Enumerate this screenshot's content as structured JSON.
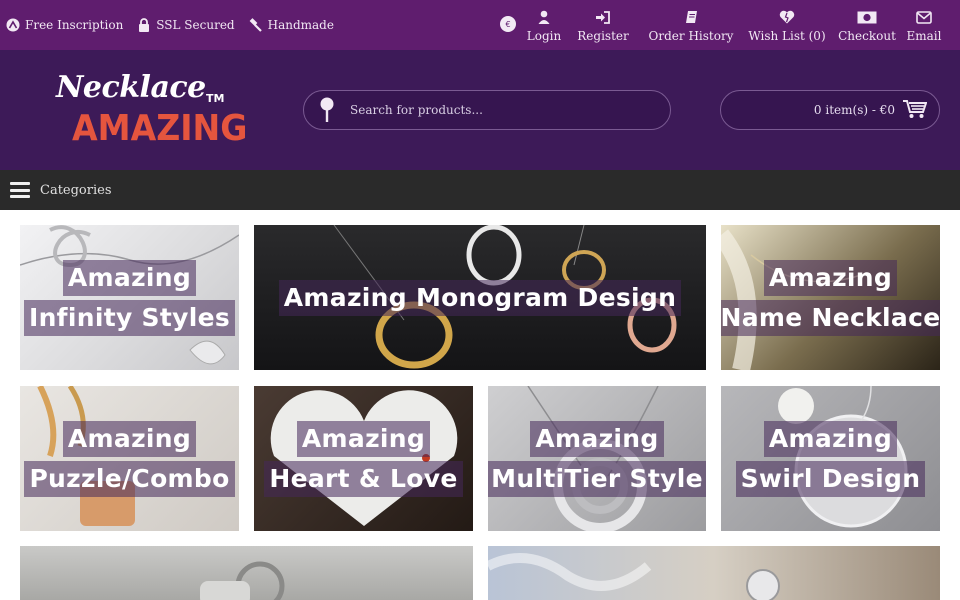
{
  "topbar": {
    "perks": [
      {
        "icon": "euro-circle-icon",
        "label": "Free Inscription"
      },
      {
        "icon": "lock-icon",
        "label": "SSL Secured"
      },
      {
        "icon": "hammer-icon",
        "label": "Handmade"
      }
    ],
    "currency_symbol": "€",
    "links": [
      {
        "icon": "user-icon",
        "label": "Login"
      },
      {
        "icon": "sign-in-icon",
        "label": "Register"
      },
      {
        "icon": "book-icon",
        "label": "Order History"
      },
      {
        "icon": "heart-icon",
        "label": "Wish List (0)"
      },
      {
        "icon": "money-icon",
        "label": "Checkout"
      },
      {
        "icon": "envelope-icon",
        "label": "Email"
      }
    ]
  },
  "header": {
    "logo_script": "Necklace",
    "logo_tm": "TM",
    "logo_main": "AMAZING",
    "search_placeholder": "Search for products...",
    "cart_label": "0 item(s) - €0"
  },
  "categories_label": "Categories",
  "tiles": [
    {
      "line1": "Amazing",
      "line2": "Infinity Styles"
    },
    {
      "line1": "Amazing Monogram Design",
      "line2": ""
    },
    {
      "line1": "Amazing",
      "line2": "Name Necklace"
    },
    {
      "line1": "Amazing",
      "line2": "Puzzle/Combo"
    },
    {
      "line1": "Amazing",
      "line2": "Heart & Love"
    },
    {
      "line1": "Amazing",
      "line2": "MultiTier Style"
    },
    {
      "line1": "Amazing",
      "line2": "Swirl Design"
    }
  ],
  "colors": {
    "topbar": "#5f1d6e",
    "header": "#3d1a58",
    "catbar": "#2a2a2a",
    "logo_accent": "#e5553e"
  }
}
